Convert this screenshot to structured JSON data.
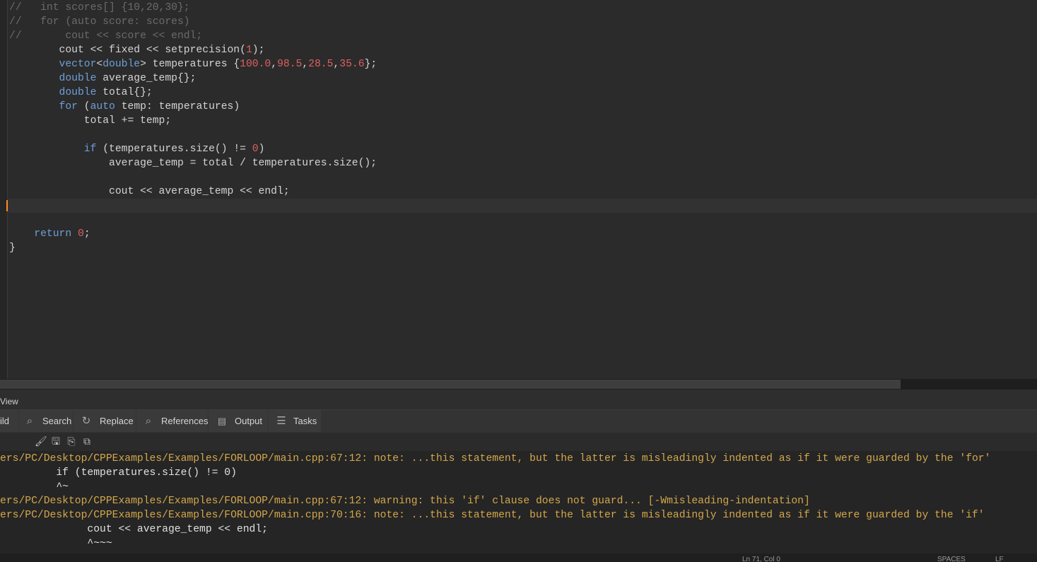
{
  "editor": {
    "lines": [
      {
        "tokens": [
          {
            "t": "//   int scores[] {10,20,30};",
            "c": "cmt"
          }
        ]
      },
      {
        "tokens": [
          {
            "t": "//   for (auto score: scores)",
            "c": "cmt"
          }
        ]
      },
      {
        "tokens": [
          {
            "t": "//       cout << score << endl;",
            "c": "cmt"
          }
        ]
      },
      {
        "tokens": [
          {
            "t": "        cout << fixed << setprecision("
          },
          {
            "t": "1",
            "c": "num"
          },
          {
            "t": ");"
          }
        ]
      },
      {
        "tokens": [
          {
            "t": "        "
          },
          {
            "t": "vector",
            "c": "kw"
          },
          {
            "t": "<"
          },
          {
            "t": "double",
            "c": "kw"
          },
          {
            "t": "> temperatures {"
          },
          {
            "t": "100.0",
            "c": "num"
          },
          {
            "t": ","
          },
          {
            "t": "98.5",
            "c": "num"
          },
          {
            "t": ","
          },
          {
            "t": "28.5",
            "c": "num"
          },
          {
            "t": ","
          },
          {
            "t": "35.6",
            "c": "num"
          },
          {
            "t": "};"
          }
        ]
      },
      {
        "tokens": [
          {
            "t": "        "
          },
          {
            "t": "double",
            "c": "kw"
          },
          {
            "t": " average_temp{};"
          }
        ]
      },
      {
        "tokens": [
          {
            "t": "        "
          },
          {
            "t": "double",
            "c": "kw"
          },
          {
            "t": " total{};"
          }
        ]
      },
      {
        "tokens": [
          {
            "t": "        "
          },
          {
            "t": "for",
            "c": "kw"
          },
          {
            "t": " ("
          },
          {
            "t": "auto",
            "c": "kw"
          },
          {
            "t": " temp: temperatures)"
          }
        ]
      },
      {
        "tokens": [
          {
            "t": "            total += temp;"
          }
        ]
      },
      {
        "tokens": [
          {
            "t": ""
          }
        ]
      },
      {
        "tokens": [
          {
            "t": "            "
          },
          {
            "t": "if",
            "c": "kw"
          },
          {
            "t": " (temperatures.size() != "
          },
          {
            "t": "0",
            "c": "num"
          },
          {
            "t": ")"
          }
        ]
      },
      {
        "tokens": [
          {
            "t": "                average_temp = total / temperatures.size();"
          }
        ]
      },
      {
        "tokens": [
          {
            "t": ""
          }
        ]
      },
      {
        "tokens": [
          {
            "t": "                cout << average_temp << endl;"
          }
        ]
      },
      {
        "tokens": [
          {
            "t": ""
          }
        ],
        "current": true
      },
      {
        "tokens": [
          {
            "t": ""
          }
        ]
      },
      {
        "tokens": [
          {
            "t": "    "
          },
          {
            "t": "return",
            "c": "kw"
          },
          {
            "t": " "
          },
          {
            "t": "0",
            "c": "num"
          },
          {
            "t": ";"
          }
        ]
      },
      {
        "tokens": [
          {
            "t": "}"
          }
        ]
      }
    ]
  },
  "panel": {
    "title": "View",
    "tabs": [
      {
        "label": "ild",
        "icon": "build-icon"
      },
      {
        "label": "Search",
        "icon": "search-icon"
      },
      {
        "label": "Replace",
        "icon": "replace-icon"
      },
      {
        "label": "References",
        "icon": "search-icon"
      },
      {
        "label": "Output",
        "icon": "terminal-icon"
      },
      {
        "label": "Tasks",
        "icon": "list-icon"
      }
    ],
    "toolbar": [
      {
        "name": "clear-icon",
        "glyph": "🖌"
      },
      {
        "name": "save-icon",
        "glyph": "🖫"
      },
      {
        "name": "copy-icon",
        "glyph": "⎘"
      },
      {
        "name": "copy-all-icon",
        "glyph": "⧉"
      }
    ],
    "log": [
      {
        "text": "ers/PC/Desktop/CPPExamples/Examples/FORLOOP/main.cpp:67:12: note: ...this statement, but the latter is misleadingly indented as if it were guarded by the 'for'",
        "c": "warn"
      },
      {
        "text": "         if (temperatures.size() != 0)",
        "c": "src"
      },
      {
        "text": "         ^~",
        "c": "src"
      },
      {
        "text": "ers/PC/Desktop/CPPExamples/Examples/FORLOOP/main.cpp:67:12: warning: this 'if' clause does not guard... [-Wmisleading-indentation]",
        "c": "warn"
      },
      {
        "text": "ers/PC/Desktop/CPPExamples/Examples/FORLOOP/main.cpp:70:16: note: ...this statement, but the latter is misleadingly indented as if it were guarded by the 'if'",
        "c": "warn"
      },
      {
        "text": "              cout << average_temp << endl;",
        "c": "src"
      },
      {
        "text": "              ^~~~",
        "c": "src"
      }
    ]
  },
  "status": {
    "position": "Ln 71, Col 0",
    "indent": "SPACES",
    "eol": "LF"
  },
  "colors": {
    "keyword": "#6f9fd8",
    "number": "#e06060",
    "comment": "#6b6b6b",
    "warning": "#d4a74a",
    "cursor": "#ff8c1a"
  }
}
